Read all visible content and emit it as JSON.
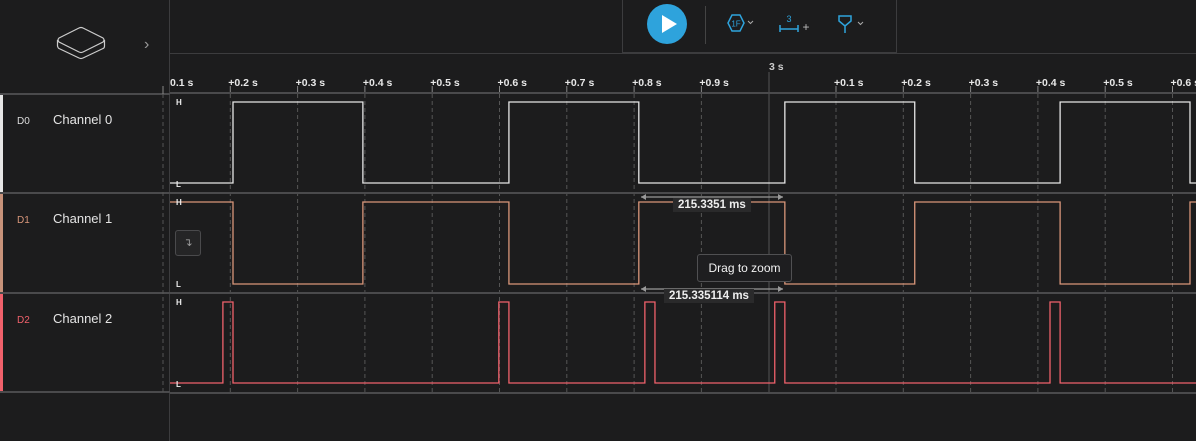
{
  "sidebar": {
    "expand_icon": "chevron-right-icon",
    "logo": "device-icon"
  },
  "toolbar": {
    "play_icon": "play-icon",
    "trigger_label": "1F",
    "measure_label": "3",
    "measure_add": "+",
    "filter_icon": "funnel-icon",
    "accent": "#2ea3dc"
  },
  "timeline": {
    "major_label": "3 s",
    "ticks": [
      "0.1 s",
      "+0.2 s",
      "+0.3 s",
      "+0.4 s",
      "+0.5 s",
      "+0.6 s",
      "+0.7 s",
      "+0.8 s",
      "+0.9 s",
      "+0.1 s",
      "+0.2 s",
      "+0.3 s",
      "+0.4 s",
      "+0.5 s",
      "+0.6 s"
    ]
  },
  "channels": [
    {
      "id": "D0",
      "name": "Channel 0",
      "color": "#e6e6e6",
      "high": "H",
      "low": "L",
      "initial": 0,
      "edges": [
        2.204,
        2.397,
        2.614,
        2.807,
        3.024,
        3.217,
        3.433,
        3.626
      ]
    },
    {
      "id": "D1",
      "name": "Channel 1",
      "color": "#d9967a",
      "high": "H",
      "low": "L",
      "initial": 1,
      "edges": [
        2.204,
        2.397,
        2.614,
        2.807,
        3.024,
        3.217,
        3.433,
        3.626
      ]
    },
    {
      "id": "D2",
      "name": "Channel 2",
      "color": "#f0616b",
      "high": "H",
      "low": "L",
      "initial": 0,
      "edges": [
        2.189,
        2.204,
        2.599,
        2.614,
        2.816,
        2.831,
        3.009,
        3.024,
        3.418,
        3.433
      ]
    }
  ],
  "measurements": {
    "upper": "215.3351 ms",
    "lower": "215.335114 ms"
  },
  "tooltip": "Drag to zoom",
  "snap_icon": "snap-edge-icon"
}
